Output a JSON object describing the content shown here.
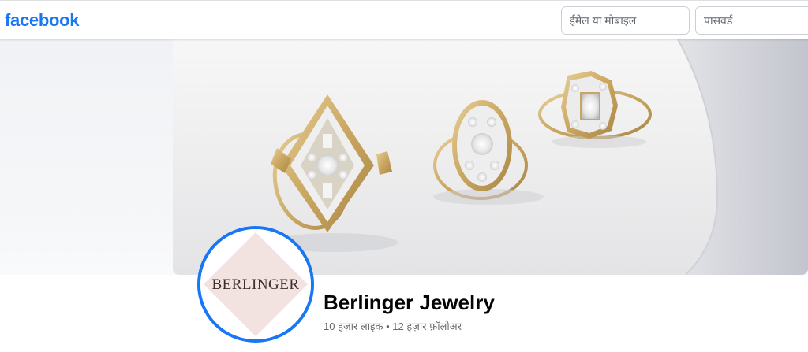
{
  "header": {
    "logo_text": "facebook",
    "email_placeholder": "ईमेल या मोबाइल",
    "password_placeholder": "पासवर्ड"
  },
  "profile": {
    "avatar_text": "BERLINGER",
    "name": "Berlinger Jewelry",
    "likes": "10 हज़ार लाइक",
    "separator": "•",
    "followers": "12 हज़ार फ़ॉलोअर"
  },
  "colors": {
    "brand": "#1877f2",
    "text_primary": "#050505",
    "text_secondary": "#65676b",
    "avatar_bg": "#f3e3e0"
  }
}
